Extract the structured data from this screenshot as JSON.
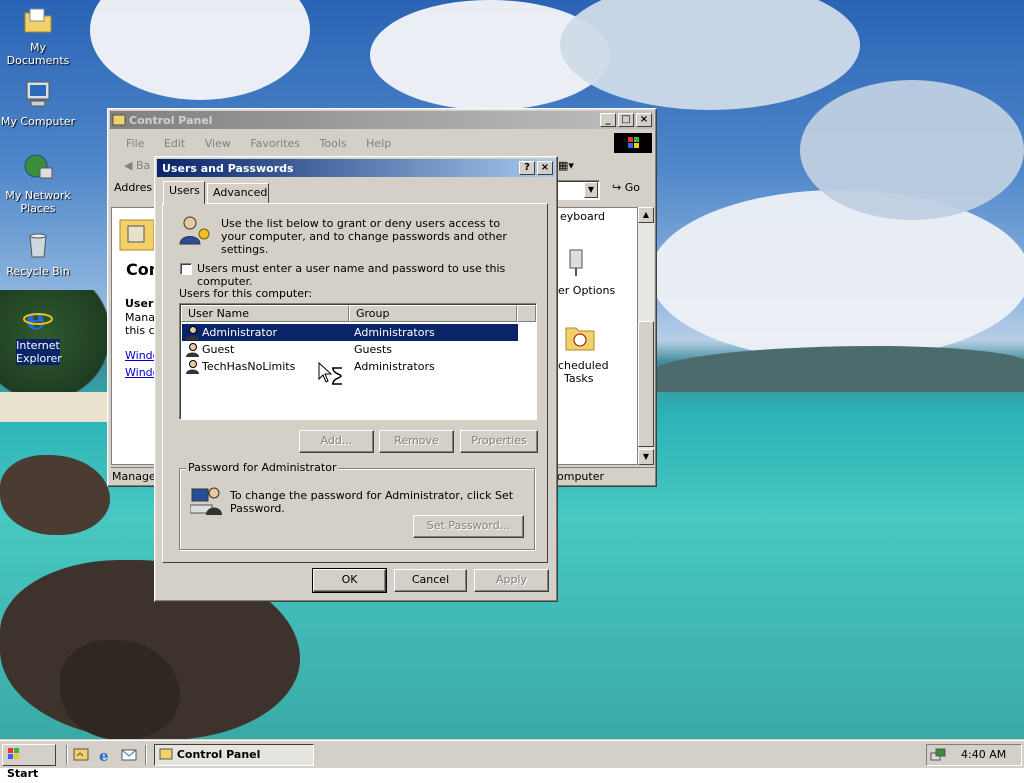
{
  "desktop": {
    "icons": [
      {
        "label": "My Documents",
        "icon": "folder-documents-icon"
      },
      {
        "label": "My Computer",
        "icon": "computer-icon"
      },
      {
        "label": "My Network Places",
        "icon": "network-icon"
      },
      {
        "label": "Recycle Bin",
        "icon": "recycle-bin-icon"
      },
      {
        "label": "Internet Explorer",
        "icon": "internet-explorer-icon"
      }
    ]
  },
  "control_panel": {
    "title": "Control Panel",
    "menu": [
      "File",
      "Edit",
      "View",
      "Favorites",
      "Tools",
      "Help"
    ],
    "back_label": "Ba",
    "address_label": "Addres",
    "go_label": "Go",
    "left_pane": {
      "heading": "Con",
      "section_title": "Users",
      "section_text_1": "Manag",
      "section_text_2": "this co",
      "link_1": "Windo",
      "link_2": "Windo"
    },
    "right_items": {
      "keyboard": "eyboard",
      "power": "er Options",
      "scheduled_1": "cheduled",
      "scheduled_2": "Tasks"
    },
    "status_left": "Manages",
    "status_right": "omputer"
  },
  "dialog": {
    "title": "Users and Passwords",
    "help_btn": "?",
    "close_btn": "×",
    "tabs": [
      "Users",
      "Advanced"
    ],
    "intro": "Use the list below to grant or deny users access to your computer, and to change passwords and other settings.",
    "checkbox_label": "Users must enter a user name and password to use this computer.",
    "checkbox_checked": false,
    "list_label": "Users for this computer:",
    "columns": [
      "User Name",
      "Group"
    ],
    "users": [
      {
        "name": "Administrator",
        "group": "Administrators",
        "selected": true
      },
      {
        "name": "Guest",
        "group": "Guests",
        "selected": false
      },
      {
        "name": "TechHasNoLimits",
        "group": "Administrators",
        "selected": false
      }
    ],
    "add_btn": "Add...",
    "remove_btn": "Remove",
    "properties_btn": "Properties",
    "password_group_title": "Password for Administrator",
    "password_text": "To change the password for Administrator, click Set Password.",
    "set_password_btn": "Set Password...",
    "ok_btn": "OK",
    "cancel_btn": "Cancel",
    "apply_btn": "Apply"
  },
  "taskbar": {
    "start_label": "Start",
    "task_label": "Control Panel",
    "clock": "4:40 AM"
  },
  "colors": {
    "selection": "#0a246a",
    "face": "#d4d0c8"
  }
}
